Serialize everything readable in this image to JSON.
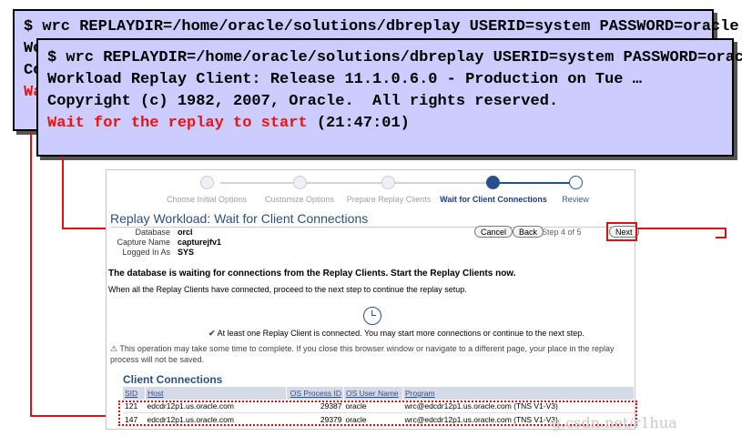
{
  "terminal_back": {
    "line1": "$ wrc REPLAYDIR=/home/oracle/solutions/dbreplay USERID=system PASSWORD=oracle",
    "line2": "Wo",
    "line3": "Co",
    "line4": "Wa"
  },
  "terminal_front": {
    "line1": "$ wrc REPLAYDIR=/home/oracle/solutions/dbreplay USERID=system PASSWORD=oracle",
    "line2": "Workload Replay Client: Release 11.1.0.6.0 - Production on Tue …",
    "line3": "Copyright (c) 1982, 2007, Oracle.  All rights reserved.",
    "line4_red": "Wait for the replay to start",
    "line4_time": " (21:47:01)"
  },
  "train": {
    "steps": [
      "Choose Initial Options",
      "Customize Options",
      "Prepare Replay Clients",
      "Wait for Client Connections",
      "Review"
    ]
  },
  "page": {
    "title": "Replay Workload: Wait for Client Connections",
    "database_label": "Database",
    "database_value": "orcl",
    "capture_label": "Capture Name",
    "capture_value": "capturejfv1",
    "logged_label": "Logged In As",
    "logged_value": "SYS",
    "cancel": "Cancel",
    "back": "Back",
    "step_text": "Step 4 of 5",
    "next": "Next",
    "message": "The database is waiting for connections from the Replay Clients. Start the Replay Clients now.",
    "sub_message": "When all the Replay Clients have connected, proceed to the next step to continue the replay setup.",
    "ok_check": "✔",
    "ok_message": "At least one Replay Client is connected. You may start more connections or continue to the next step.",
    "warn_icon": "⚠",
    "warning": "This operation may take some time to complete. If you close this browser window or navigate to a different page, your place in the replay process will not be saved."
  },
  "connections": {
    "title": "Client Connections",
    "headers": [
      "SID",
      "Host",
      "OS Process ID",
      "OS User Name",
      "Program"
    ],
    "rows": [
      [
        "121",
        "edcdr12p1.us.oracle.com",
        "29387",
        "oracle",
        "wrc@edcdr12p1.us.oracle.com (TNS V1-V3)"
      ],
      [
        "147",
        "edcdr12p1.us.oracle.com",
        "29379",
        "oracle",
        "wrc@edcdr12p1.us.oracle.com (TNS V1-V3)"
      ]
    ]
  },
  "watermark": "g.csdn.net/r1hua",
  "colors": {
    "terminal_bg": "#ccccff",
    "highlight": "#e01010",
    "oracle_blue": "#2a4f8f"
  }
}
